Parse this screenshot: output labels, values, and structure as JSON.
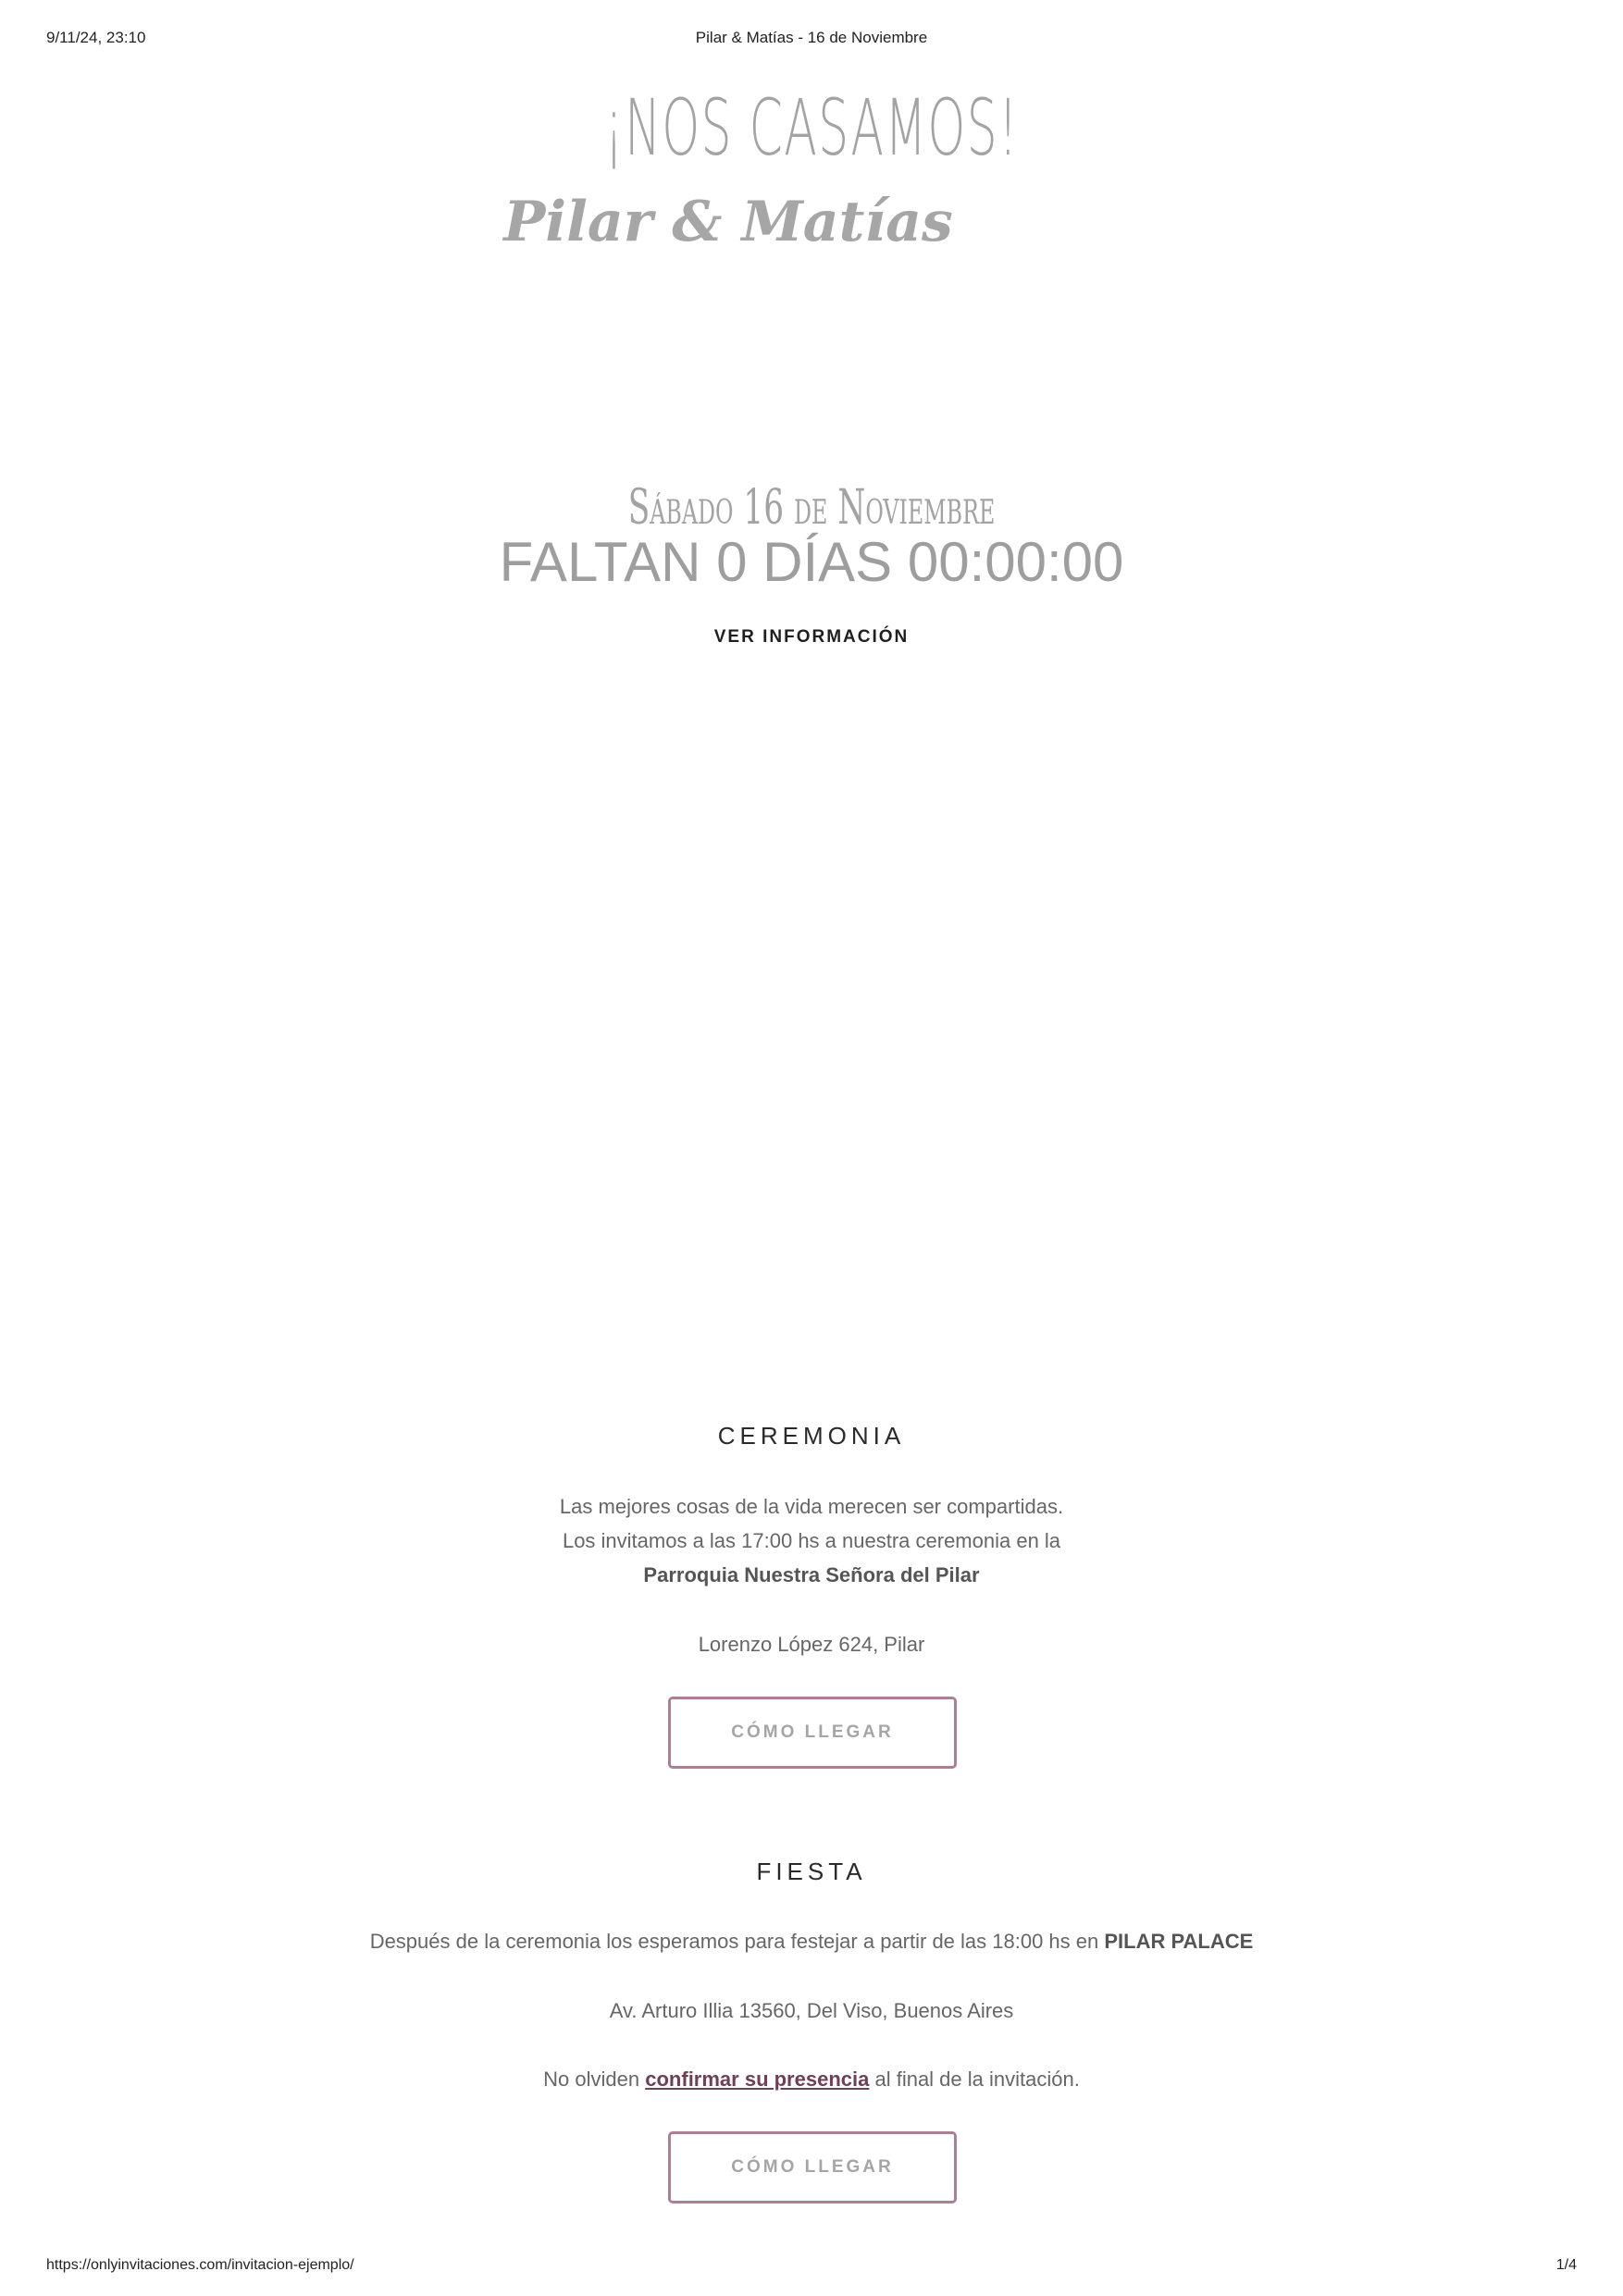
{
  "print_header": {
    "timestamp": "9/11/24, 23:10",
    "title": "Pilar & Matías - 16 de Noviembre"
  },
  "print_footer": {
    "url": "https://onlyinvitaciones.com/invitacion-ejemplo/",
    "page": "1/4"
  },
  "hero": {
    "heading": "¡NOS CASAMOS!",
    "names": "Pilar & Matías",
    "date": "Sábado 16 de Noviembre",
    "countdown": "FALTAN 0 DÍAS 00:00:00",
    "info_link": "VER INFORMACIÓN"
  },
  "ceremonia": {
    "title": "CEREMONIA",
    "line1": "Las mejores cosas de la vida merecen ser compartidas.",
    "line2": "Los invitamos a las 17:00 hs a nuestra ceremonia en la",
    "venue": "Parroquia Nuestra Señora del Pilar",
    "address": "Lorenzo López 624, Pilar",
    "button": "CÓMO LLEGAR"
  },
  "fiesta": {
    "title": "FIESTA",
    "line1_prefix": "Después de la ceremonia los esperamos para festejar a partir de las 18:00 hs en ",
    "venue": "PILAR PALACE",
    "address": "Av. Arturo Illia 13560, Del Viso, Buenos Aires",
    "rsvp_prefix": "No olviden ",
    "rsvp_link": "confirmar su presencia",
    "rsvp_suffix": " al final de la invitación.",
    "button": "CÓMO LLEGAR"
  },
  "colors": {
    "accent": "#ad7f94",
    "link": "#6f3f55",
    "hero_text": "#a3a3a3",
    "body_text": "#666666"
  }
}
